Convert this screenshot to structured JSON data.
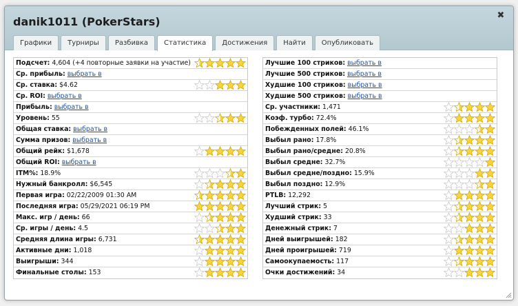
{
  "window": {
    "title": "danik1011 (PokerStars)",
    "close_glyph": "✖"
  },
  "tabs": [
    {
      "label": "Графики"
    },
    {
      "label": "Турниры"
    },
    {
      "label": "Разбивка"
    },
    {
      "label": "Статистика",
      "active": true
    },
    {
      "label": "Достижения"
    },
    {
      "label": "Найти"
    },
    {
      "label": "Опубликовать"
    }
  ],
  "left": [
    {
      "label": "Подсчет:",
      "value": "4,604 (+4 повторные заявки на участие)",
      "stars": 4.5
    },
    {
      "label": "Ср. прибыль:",
      "link": "выбрать в"
    },
    {
      "label": "Ср. ставка:",
      "value": "$4.62",
      "stars": 3
    },
    {
      "label": "Ср. ROI:",
      "link": "выбрать в"
    },
    {
      "label": "Прибыль:",
      "link": "выбрать в"
    },
    {
      "label": "Уровень:",
      "value": "55",
      "stars": 2.5
    },
    {
      "label": "Общая ставка:",
      "link": "выбрать в"
    },
    {
      "label": "Сумма призов:",
      "link": "выбрать в"
    },
    {
      "label": "Общий рейк:",
      "value": "$1,678",
      "stars": 4
    },
    {
      "label": "Общий ROI:",
      "link": "выбрать в"
    },
    {
      "label": "ITM%:",
      "value": "18.9%",
      "stars": 1.5
    },
    {
      "label": "Нужный банкролл:",
      "value": "$6,545",
      "stars": 3.5
    },
    {
      "label": "Первая игра:",
      "value": "02/22/2009 01:30 AM",
      "stars": 4.5
    },
    {
      "label": "Последняя игра:",
      "value": "05/29/2021 06:19 PM",
      "stars": 5
    },
    {
      "label": "Макс. игр / день:",
      "value": "66",
      "stars": 3.5
    },
    {
      "label": "Ср. игры / день:",
      "value": "4.5",
      "stars": 2.5
    },
    {
      "label": "Средняя длина игры:",
      "value": "6,731",
      "stars": 4.5
    },
    {
      "label": "Активные дни:",
      "value": "1,018",
      "stars": 4
    },
    {
      "label": "Выигрыши:",
      "value": "344",
      "stars": 4
    },
    {
      "label": "Финальные столы:",
      "value": "153",
      "stars": 4
    }
  ],
  "right": [
    {
      "label": "Лучшие 100 стриков:",
      "link": "выбрать в"
    },
    {
      "label": "Лучшие 500 стриков:",
      "link": "выбрать в"
    },
    {
      "label": "Худшие 100 стриков:",
      "link": "выбрать в"
    },
    {
      "label": "Худшие 500 стриков:",
      "link": "выбрать в"
    },
    {
      "label": "Ср. участники:",
      "value": "1,471",
      "stars": 3.5
    },
    {
      "label": "Коэф. турбо:",
      "value": "72.4%",
      "stars": 4
    },
    {
      "label": "Побежденных полей:",
      "value": "46.1%",
      "stars": 1.5
    },
    {
      "label": "Выбыл рано:",
      "value": "17.8%",
      "stars": 3.5
    },
    {
      "label": "Выбыл рано/средне:",
      "value": "20.8%",
      "stars": 3.5
    },
    {
      "label": "Выбыл средне:",
      "value": "32.7%",
      "stars": 1
    },
    {
      "label": "Выбыл средне/поздно:",
      "value": "15.9%",
      "stars": 2
    },
    {
      "label": "Выбыл поздно:",
      "value": "12.9%",
      "stars": 1.5
    },
    {
      "label": "PTLB:",
      "value": "12,292",
      "stars": 4
    },
    {
      "label": "Лучший стрик:",
      "value": "5",
      "stars": 3.5
    },
    {
      "label": "Худший стрик:",
      "value": "33",
      "stars": 3.5
    },
    {
      "label": "Денежный стрик:",
      "value": "7",
      "stars": 3
    },
    {
      "label": "Дней выигрышей:",
      "value": "182",
      "stars": 3.5
    },
    {
      "label": "Дней проигрышей:",
      "value": "719",
      "stars": 4
    },
    {
      "label": "Самоокупаемость:",
      "value": "117",
      "stars": 3.5
    },
    {
      "label": "Очки достижений:",
      "value": "34",
      "stars": 3
    }
  ],
  "colors": {
    "star_fill": "#f7d53c",
    "star_stroke": "#d9a800",
    "star_empty": "#c9c9c9",
    "link": "#1f4f9c"
  }
}
